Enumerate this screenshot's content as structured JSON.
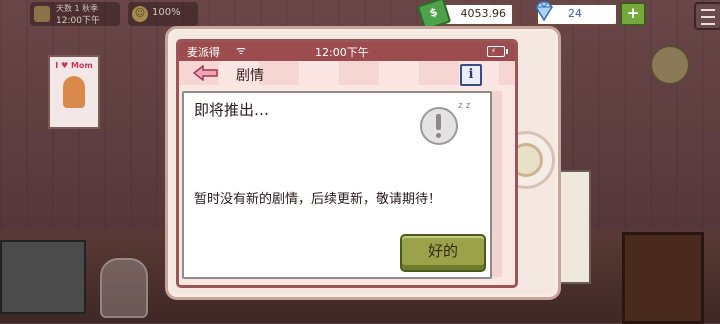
{
  "hud": {
    "time_top": "天数 1 秋季",
    "time_clock": "12:00下午",
    "happiness": "100%",
    "money": "4053.96",
    "gems": "24",
    "plus_label": "+"
  },
  "scene": {
    "poster_text": "I ♥ Mom"
  },
  "phone": {
    "status": {
      "carrier": "麦派得",
      "clock": "12:00下午"
    },
    "header": {
      "title": "剧情",
      "info_label": "i"
    },
    "card": {
      "title": "即将推出…",
      "sleep_mark": "z z",
      "message": "暂时没有新的剧情，后续更新，敬请期待！",
      "ok_label": "好的"
    }
  },
  "colors": {
    "status_bar": "#9c4c4f",
    "ok_button": "#9aa24a",
    "money_icon": "#4ea34a",
    "gem_text": "#3a5da8"
  }
}
